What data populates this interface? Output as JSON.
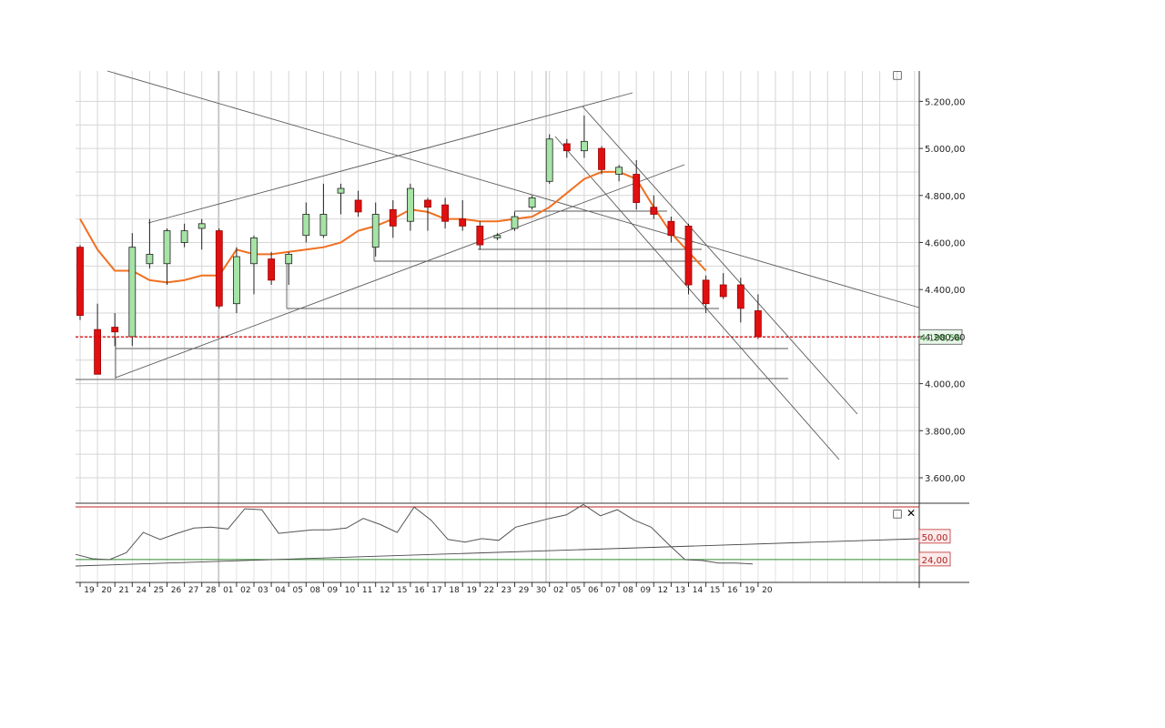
{
  "window": {
    "maximize_glyph": "□",
    "close_glyph": "✕"
  },
  "chart_data": [
    {
      "type": "candlestick",
      "title": "",
      "ylim": [
        3500,
        5320
      ],
      "y_ticks": [
        "3.600,00",
        "3.800,00",
        "4.000,00",
        "4.200,00",
        "4.400,00",
        "4.600,00",
        "4.800,00",
        "5.000,00",
        "5.200,00"
      ],
      "x_labels": [
        "19",
        "20",
        "21",
        "24",
        "25",
        "26",
        "27",
        "28",
        "01",
        "02",
        "03",
        "04",
        "05",
        "08",
        "09",
        "10",
        "11",
        "12",
        "15",
        "16",
        "17",
        "18",
        "19",
        "22",
        "23",
        "29",
        "30",
        "02",
        "05",
        "06",
        "07",
        "08",
        "09",
        "12",
        "13",
        "14",
        "15",
        "16",
        "19",
        "20"
      ],
      "last_price_label": "4.198,56",
      "last_price": 4198.56,
      "candles": [
        {
          "o": 4580,
          "h": 4590,
          "l": 4270,
          "c": 4290
        },
        {
          "o": 4230,
          "h": 4340,
          "l": 4040,
          "c": 4040
        },
        {
          "o": 4240,
          "h": 4300,
          "l": 4160,
          "c": 4220
        },
        {
          "o": 4200,
          "h": 4640,
          "l": 4160,
          "c": 4580
        },
        {
          "o": 4510,
          "h": 4700,
          "l": 4490,
          "c": 4550
        },
        {
          "o": 4510,
          "h": 4660,
          "l": 4420,
          "c": 4650
        },
        {
          "o": 4600,
          "h": 4680,
          "l": 4580,
          "c": 4650
        },
        {
          "o": 4660,
          "h": 4700,
          "l": 4570,
          "c": 4680
        },
        {
          "o": 4650,
          "h": 4660,
          "l": 4320,
          "c": 4330
        },
        {
          "o": 4340,
          "h": 4580,
          "l": 4300,
          "c": 4540
        },
        {
          "o": 4510,
          "h": 4630,
          "l": 4380,
          "c": 4620
        },
        {
          "o": 4530,
          "h": 4560,
          "l": 4420,
          "c": 4440
        },
        {
          "o": 4510,
          "h": 4560,
          "l": 4420,
          "c": 4550
        },
        {
          "o": 4630,
          "h": 4770,
          "l": 4600,
          "c": 4720
        },
        {
          "o": 4630,
          "h": 4850,
          "l": 4620,
          "c": 4720
        },
        {
          "o": 4810,
          "h": 4850,
          "l": 4720,
          "c": 4830
        },
        {
          "o": 4780,
          "h": 4820,
          "l": 4710,
          "c": 4730
        },
        {
          "o": 4580,
          "h": 4770,
          "l": 4540,
          "c": 4720
        },
        {
          "o": 4740,
          "h": 4780,
          "l": 4620,
          "c": 4670
        },
        {
          "o": 4690,
          "h": 4850,
          "l": 4650,
          "c": 4830
        },
        {
          "o": 4780,
          "h": 4790,
          "l": 4650,
          "c": 4750
        },
        {
          "o": 4760,
          "h": 4790,
          "l": 4660,
          "c": 4690
        },
        {
          "o": 4700,
          "h": 4780,
          "l": 4650,
          "c": 4670
        },
        {
          "o": 4670,
          "h": 4690,
          "l": 4570,
          "c": 4590
        },
        {
          "o": 4620,
          "h": 4640,
          "l": 4610,
          "c": 4630
        },
        {
          "o": 4660,
          "h": 4730,
          "l": 4650,
          "c": 4710
        },
        {
          "o": 4750,
          "h": 4800,
          "l": 4740,
          "c": 4790
        },
        {
          "o": 4860,
          "h": 5060,
          "l": 4850,
          "c": 5040
        },
        {
          "o": 5020,
          "h": 5040,
          "l": 4960,
          "c": 4990
        },
        {
          "o": 4990,
          "h": 5140,
          "l": 4960,
          "c": 5030
        },
        {
          "o": 5000,
          "h": 5010,
          "l": 4890,
          "c": 4910
        },
        {
          "o": 4890,
          "h": 4930,
          "l": 4860,
          "c": 4920
        },
        {
          "o": 4890,
          "h": 4950,
          "l": 4740,
          "c": 4770
        },
        {
          "o": 4750,
          "h": 4800,
          "l": 4700,
          "c": 4720
        },
        {
          "o": 4690,
          "h": 4710,
          "l": 4600,
          "c": 4630
        },
        {
          "o": 4670,
          "h": 4680,
          "l": 4380,
          "c": 4420
        },
        {
          "o": 4440,
          "h": 4460,
          "l": 4300,
          "c": 4340
        },
        {
          "o": 4420,
          "h": 4470,
          "l": 4360,
          "c": 4370
        },
        {
          "o": 4420,
          "h": 4450,
          "l": 4260,
          "c": 4320
        },
        {
          "o": 4310,
          "h": 4380,
          "l": 4190,
          "c": 4200
        }
      ],
      "moving_average": [
        4700,
        4570,
        4480,
        4480,
        4440,
        4430,
        4440,
        4460,
        4460,
        4570,
        4550,
        4550,
        4560,
        4570,
        4580,
        4600,
        4650,
        4670,
        4700,
        4740,
        4730,
        4700,
        4700,
        4690,
        4690,
        4700,
        4710,
        4750,
        4810,
        4870,
        4900,
        4900,
        4870,
        4750,
        4640,
        4560,
        4480
      ]
    },
    {
      "type": "line",
      "title": "",
      "ylim": [
        0,
        100
      ],
      "levels": [
        {
          "label": "50,00",
          "value": 50,
          "color": "#2e8b2e"
        },
        {
          "label": "24,00",
          "value": 24,
          "color": "#2e8b2e"
        }
      ],
      "values": [
        32,
        27,
        26,
        34,
        57,
        49,
        56,
        62,
        63,
        61,
        84,
        83,
        56,
        58,
        60,
        60,
        62,
        73,
        66,
        57,
        86,
        71,
        49,
        46,
        50,
        48,
        63,
        68,
        73,
        77,
        89,
        76,
        83,
        71,
        63,
        44,
        26,
        25,
        22,
        22,
        21
      ]
    }
  ]
}
